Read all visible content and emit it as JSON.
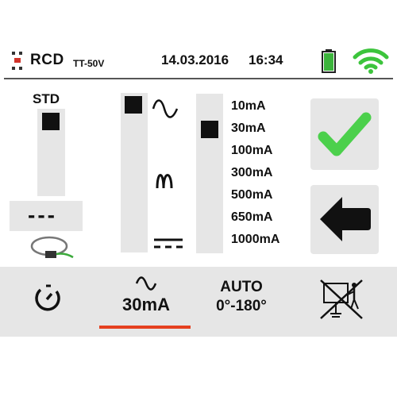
{
  "header": {
    "title": "RCD",
    "subtitle": "TT-50V",
    "date": "14.03.2016",
    "time": "16:34",
    "icons": [
      "rcd-connection-icon",
      "battery-icon",
      "wifi-icon"
    ],
    "colors": {
      "battery": "#3cb43c",
      "wifi": "#3cc43c"
    }
  },
  "std_panel": {
    "label": "STD",
    "dc_symbol": "---"
  },
  "waveforms": [
    "ac-sine",
    "half-wave-pulse",
    "dc"
  ],
  "currents": [
    "10mA",
    "30mA",
    "100mA",
    "300mA",
    "500mA",
    "650mA",
    "1000mA"
  ],
  "selected_current": "30mA",
  "side_buttons": [
    "confirm-check",
    "back-arrow"
  ],
  "tabs": {
    "timer": {
      "icon": "timer-icon"
    },
    "current": {
      "value": "30mA"
    },
    "phase": {
      "line1": "AUTO",
      "line2": "0°-180°"
    },
    "touch": {
      "icon": "touch-voltage-disabled-icon"
    }
  },
  "accent": "#e5401f",
  "check_color": "#4cd04c"
}
